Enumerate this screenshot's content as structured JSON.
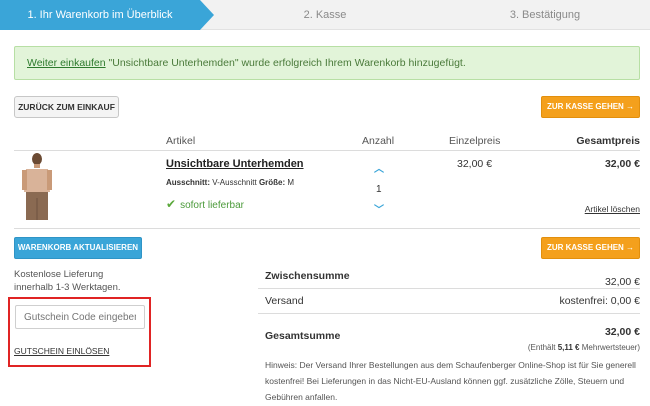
{
  "steps": {
    "step1": "1. Ihr Warenkorb im Überblick",
    "step2": "2. Kasse",
    "step3": "3. Bestätigung"
  },
  "alert": {
    "link": "Weiter einkaufen",
    "message": " \"Unsichtbare Unterhemden\" wurde erfolgreich Ihrem Warenkorb hinzugefügt."
  },
  "buttons": {
    "back": "ZURÜCK ZUM EINKAUF",
    "checkout_top": "ZUR KASSE GEHEN →",
    "update": "WARENKORB AKTUALISIEREN",
    "checkout_bottom": "ZUR KASSE GEHEN →"
  },
  "table": {
    "col_article": "Artikel",
    "col_qty": "Anzahl",
    "col_unit": "Einzelpreis",
    "col_total": "Gesamtpreis"
  },
  "item": {
    "name": "Unsichtbare Unterhemden",
    "cut_label": "Ausschnitt:",
    "cut_value": "V-Ausschnitt",
    "size_label": "Größe:",
    "size_value": "M",
    "availability": "sofort lieferbar",
    "quantity": "1",
    "unit_price": "32,00 €",
    "total_price": "32,00 €",
    "delete": "Artikel löschen"
  },
  "shipping_note": {
    "line1": "Kostenlose Lieferung",
    "line2": "innerhalb 1-3 Werktagen."
  },
  "voucher": {
    "placeholder": "Gutschein Code eingeben",
    "redeem": "GUTSCHEIN EINLÖSEN"
  },
  "summary": {
    "subtotal_label": "Zwischensumme",
    "subtotal_value": "32,00 €",
    "shipping_label": "Versand",
    "shipping_value": "kostenfrei: 0,00 €",
    "total_label": "Gesamtsumme",
    "total_value": "32,00 €",
    "vat_prefix": "(Enthält",
    "vat_amount": "5,11 €",
    "vat_suffix": "Mehrwertsteuer)",
    "hint": "Hinweis: Der Versand Ihrer Bestellungen aus dem Schaufenberger Online-Shop ist für Sie generell kostenfrei! Bei Lieferungen in das Nicht-EU-Ausland können ggf. zusätzliche Zölle, Steuern und Gebühren anfallen."
  },
  "colors": {
    "accent_blue": "#3aa5d8",
    "accent_orange": "#f4a01c",
    "success_green": "#4b9a3a",
    "highlight_red": "#e02424"
  }
}
